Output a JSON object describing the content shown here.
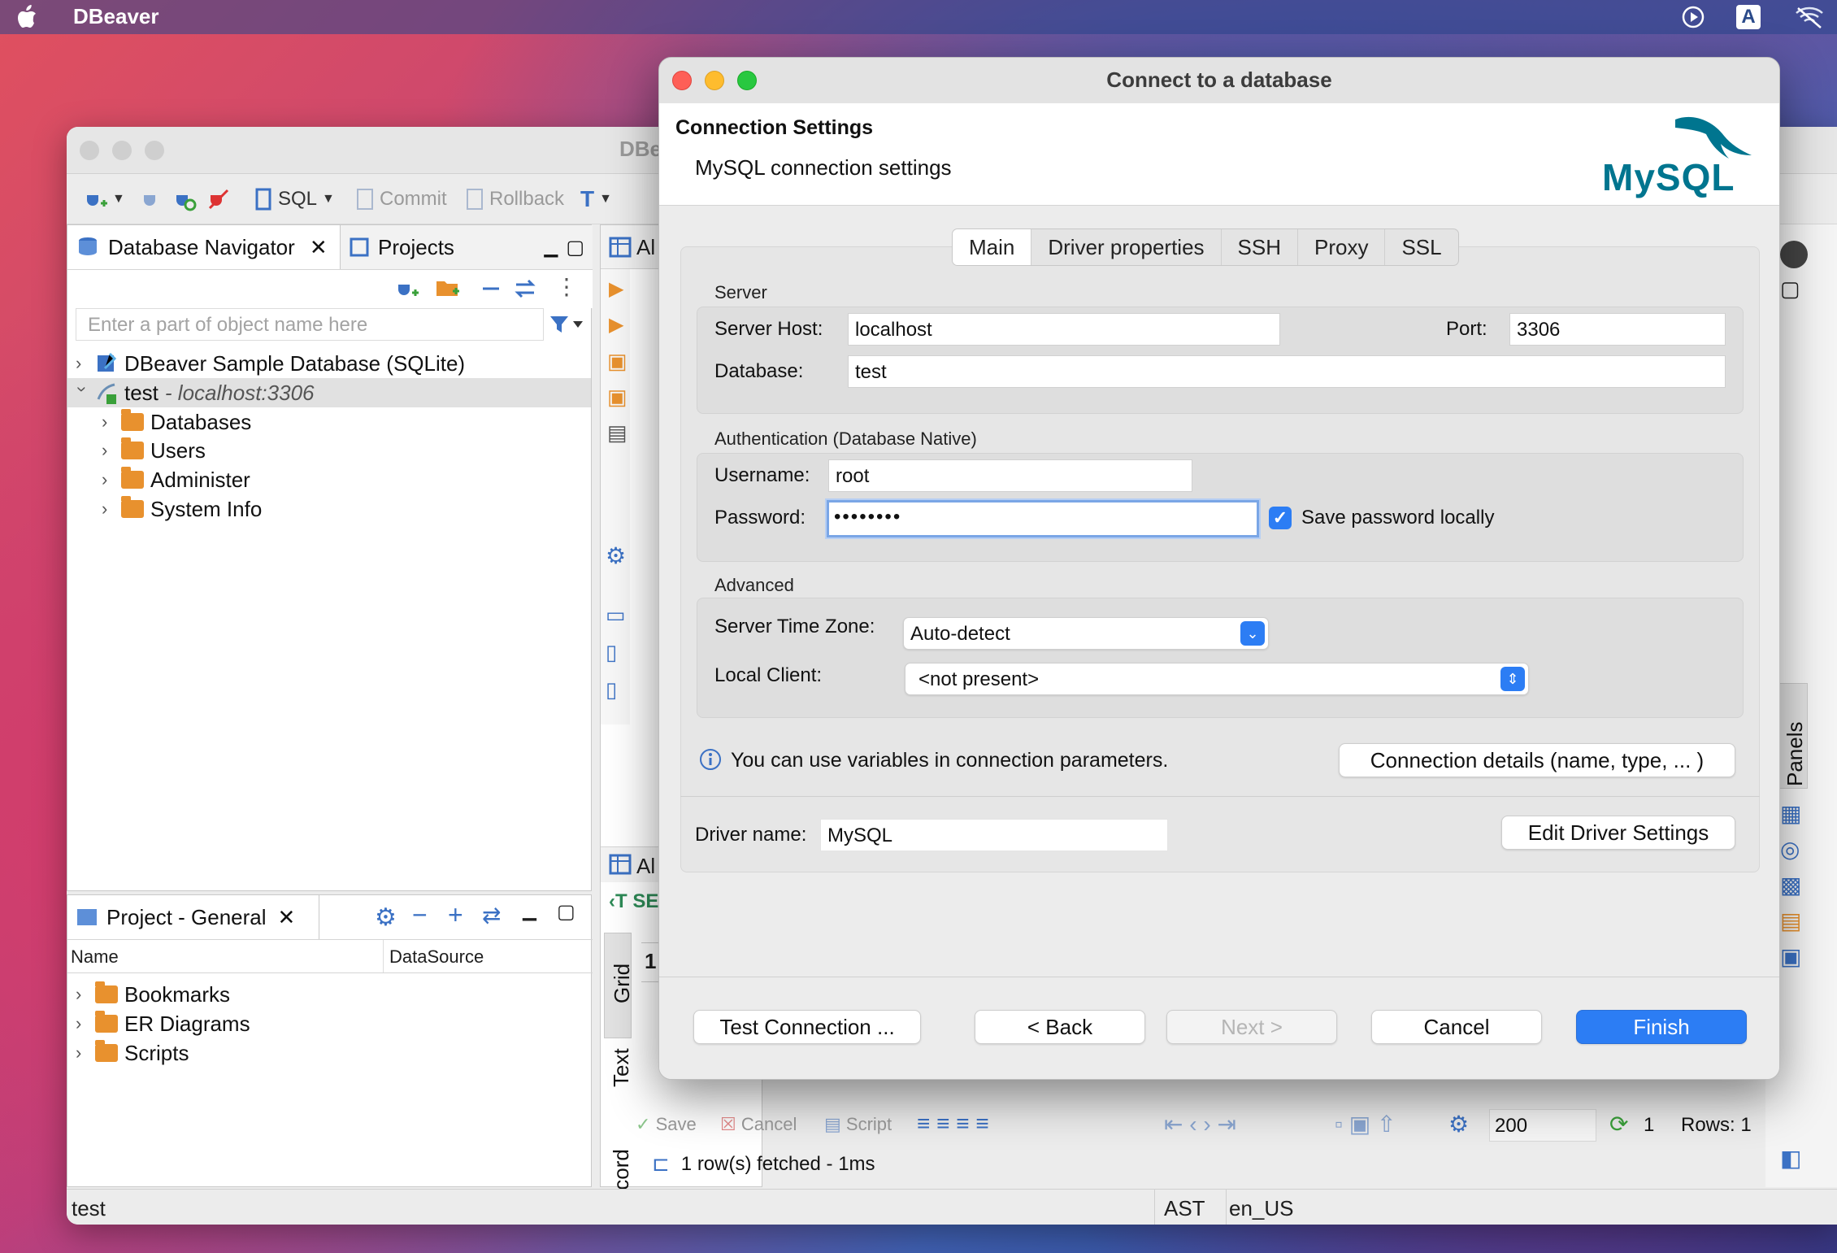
{
  "menubar": {
    "app_name": "DBeaver"
  },
  "main_window": {
    "title": "DBe",
    "toolbar": {
      "sql": "SQL",
      "commit": "Commit",
      "rollback": "Rollback"
    },
    "navigator": {
      "tab_database_navigator": "Database Navigator",
      "tab_projects": "Projects",
      "filter_placeholder": "Enter a part of object name here",
      "tree": [
        {
          "label": "DBeaver Sample Database (SQLite)"
        },
        {
          "label": "test",
          "suffix": " - localhost:3306"
        },
        {
          "label": "Databases"
        },
        {
          "label": "Users"
        },
        {
          "label": "Administer"
        },
        {
          "label": "System Info"
        }
      ]
    },
    "project_panel": {
      "tab": "Project - General",
      "col_name": "Name",
      "col_datasource": "DataSource",
      "items": [
        "Bookmarks",
        "ER Diagrams",
        "Scripts"
      ]
    },
    "editor": {
      "tab_fragment_top": "Al",
      "tab_fragment_mid": "Al",
      "sql_fragment": "SE",
      "row_number": "1",
      "vtab_grid": "Grid",
      "vtab_text": "Text",
      "vtab_record": "Record",
      "vtab_panels": "Panels",
      "bottom_toolbar": {
        "save": "Save",
        "cancel": "Cancel",
        "script": "Script",
        "fetch_size": "200",
        "refresh_count": "1",
        "rows": "Rows: 1"
      },
      "fetch_status": "1 row(s) fetched - 1ms"
    },
    "statusbar": {
      "left": "test",
      "timezone": "AST",
      "locale": "en_US"
    }
  },
  "dialog": {
    "title": "Connect to a database",
    "header_title": "Connection Settings",
    "header_subtitle": "MySQL connection settings",
    "logo_text": "MySQL",
    "tabs": [
      "Main",
      "Driver properties",
      "SSH",
      "Proxy",
      "SSL"
    ],
    "selected_tab": "Main",
    "server": {
      "group_label": "Server",
      "host_label": "Server Host:",
      "host_value": "localhost",
      "port_label": "Port:",
      "port_value": "3306",
      "database_label": "Database:",
      "database_value": "test"
    },
    "auth": {
      "group_label": "Authentication (Database Native)",
      "username_label": "Username:",
      "username_value": "root",
      "password_label": "Password:",
      "password_value": "••••••••",
      "save_password_label": "Save password locally",
      "save_password_checked": true
    },
    "advanced": {
      "group_label": "Advanced",
      "timezone_label": "Server Time Zone:",
      "timezone_value": "Auto-detect",
      "local_client_label": "Local Client:",
      "local_client_value": "<not present>"
    },
    "info_text": "You can use variables in connection parameters.",
    "connection_details_button": "Connection details (name, type, ... )",
    "driver_name_label": "Driver name:",
    "driver_name_value": "MySQL",
    "edit_driver_button": "Edit Driver Settings",
    "footer": {
      "test_connection": "Test Connection ...",
      "back": "< Back",
      "next": "Next >",
      "cancel": "Cancel",
      "finish": "Finish"
    },
    "colors": {
      "accent": "#2c7df4",
      "mysql_blue": "#00758f",
      "mysql_orange": "#f29111"
    }
  }
}
